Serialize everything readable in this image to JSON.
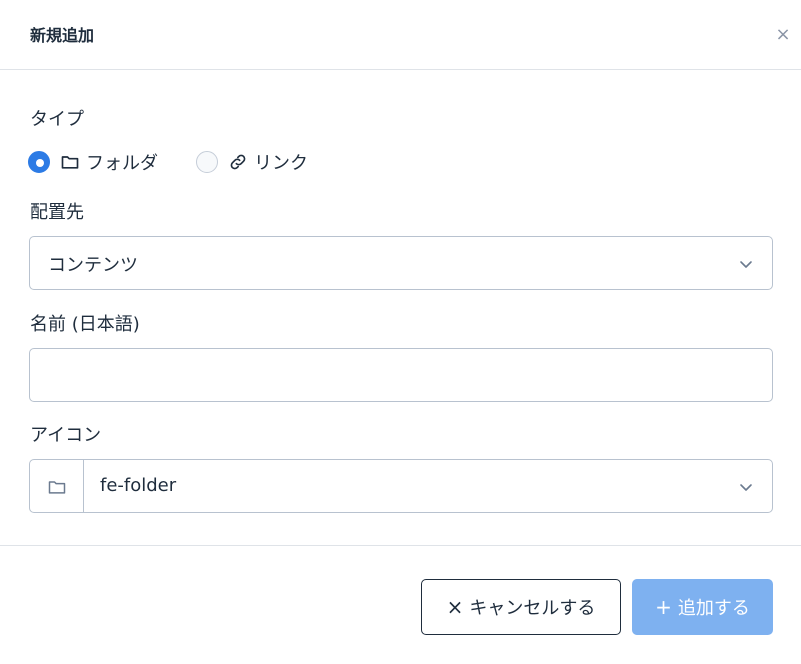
{
  "dialog": {
    "title": "新規追加",
    "close_symbol": "×"
  },
  "type_field": {
    "label": "タイプ",
    "options": [
      {
        "label": "フォルダ",
        "icon": "folder-icon",
        "selected": true
      },
      {
        "label": "リンク",
        "icon": "link-icon",
        "selected": false
      }
    ]
  },
  "location_field": {
    "label": "配置先",
    "selected_value": "コンテンツ"
  },
  "name_field": {
    "label": "名前 (日本語)",
    "value": "",
    "placeholder": ""
  },
  "icon_field": {
    "label": "アイコン",
    "selected_value": "fe-folder",
    "prefix_icon": "folder-icon"
  },
  "footer": {
    "cancel_symbol": "×",
    "cancel_label": "キャンセルする",
    "add_symbol": "+",
    "add_label": "追加する"
  },
  "colors": {
    "accent": "#2c7be5",
    "add_button_disabled": "#7eb1f0",
    "border": "#b8c2cf",
    "text": "#1f2d3d"
  }
}
